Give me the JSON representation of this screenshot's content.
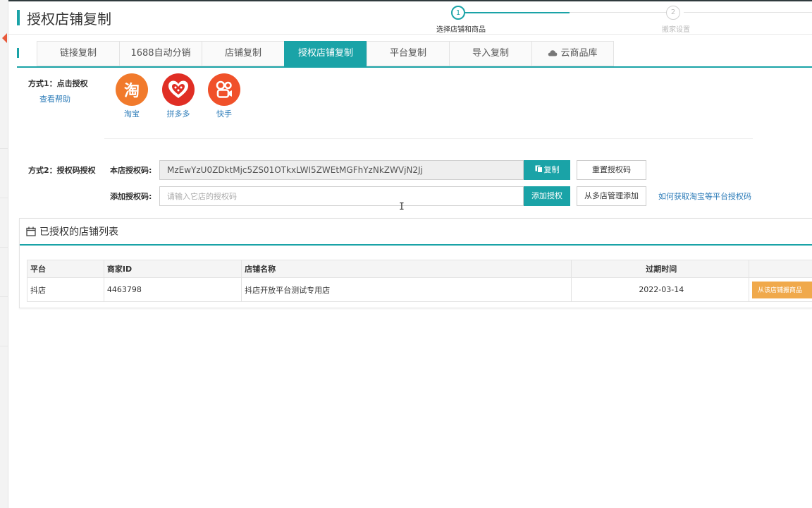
{
  "page": {
    "title": "授权店铺复制"
  },
  "steps": [
    {
      "number": "1",
      "label": "选择店铺和商品"
    },
    {
      "number": "2",
      "label": "搬家设置"
    }
  ],
  "tabs": [
    {
      "label": "链接复制"
    },
    {
      "label": "1688自动分销"
    },
    {
      "label": "店铺复制"
    },
    {
      "label": "授权店铺复制"
    },
    {
      "label": "平台复制"
    },
    {
      "label": "导入复制"
    },
    {
      "label": "云商品库",
      "icon": "cloud-icon"
    }
  ],
  "method1": {
    "title": "方式1：点击授权",
    "help": "查看帮助",
    "platforms": [
      {
        "name": "淘宝",
        "glyph": "淘",
        "color": "#f17a2c",
        "icon": "taobao-logo-icon"
      },
      {
        "name": "拼多多",
        "color": "#e02e24",
        "icon": "pinduoduo-logo-icon"
      },
      {
        "name": "快手",
        "color": "#f0512a",
        "icon": "kuaishou-logo-icon"
      }
    ]
  },
  "method2": {
    "title": "方式2：授权码授权",
    "own_code_label": "本店授权码:",
    "own_code_value": "MzEwYzU0ZDktMjc5ZS01OTkxLWI5ZWEtMGFhYzNkZWVjN2Jj",
    "copy_button": "复制",
    "reset_button": "重置授权码",
    "add_code_label": "添加授权码:",
    "add_code_placeholder": "请输入它店的授权码",
    "add_button": "添加授权",
    "multi_shop_button": "从多店管理添加",
    "how_link": "如何获取淘宝等平台授权码"
  },
  "shop_list": {
    "title": "已授权的店铺列表",
    "columns": [
      "平台",
      "商家ID",
      "店铺名称",
      "过期时间"
    ],
    "rows": [
      {
        "platform": "抖店",
        "merchant_id": "4463798",
        "shop_name": "抖店开放平台测试专用店",
        "expire": "2022-03-14",
        "action": "从该店铺搬商品"
      }
    ]
  },
  "colors": {
    "accent": "#1aa3a7",
    "link": "#2b7bb8",
    "action": "#f0a94b"
  }
}
